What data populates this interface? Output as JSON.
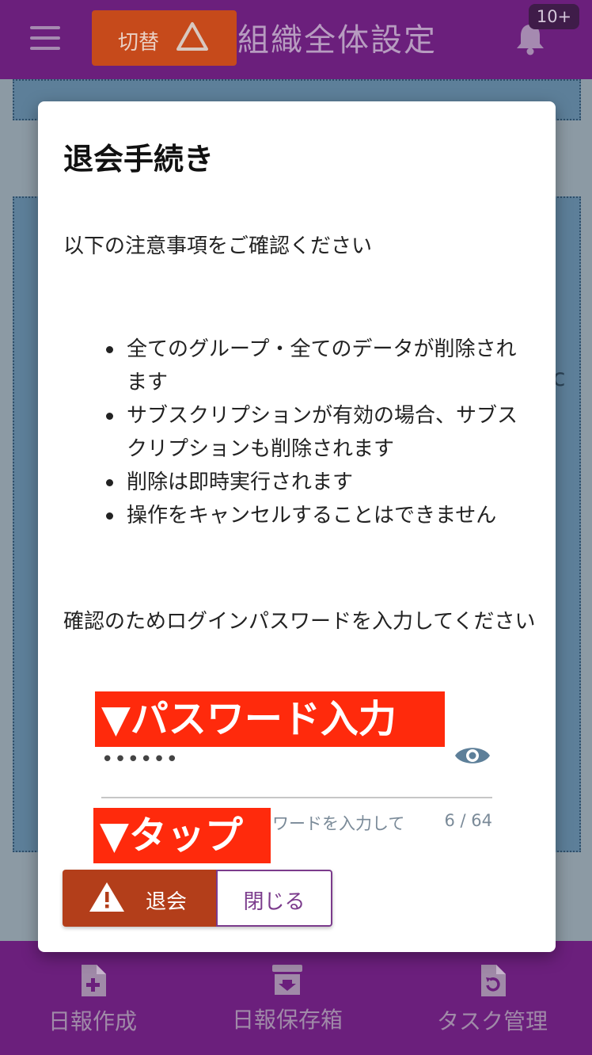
{
  "header": {
    "switch_label": "切替",
    "title": "組織全体設定",
    "notification_badge": "10+"
  },
  "background": {
    "partial_letter": "c"
  },
  "dialog": {
    "title": "退会手続き",
    "intro": "以下の注意事項をご確認ください",
    "notes": [
      "全てのグループ・全てのデータが削除されます",
      "サブスクリプションが有効の場合、サブスクリプションも削除されます",
      "削除は即時実行されます",
      "操作をキャンセルすることはできません"
    ],
    "confirm_text": "確認のためログインパスワードを入力してください",
    "password": {
      "value": "••••••",
      "hint": "ワードを入力して",
      "counter": "6 / 64"
    },
    "withdraw_label": "退会",
    "close_label": "閉じる"
  },
  "annotations": {
    "password_input": "▼パスワード入力",
    "tap": "▼タップ"
  },
  "bottom_nav": [
    {
      "label": "日報作成",
      "icon": "file-plus-icon"
    },
    {
      "label": "日報保存箱",
      "icon": "archive-icon"
    },
    {
      "label": "タスク管理",
      "icon": "file-refresh-icon"
    }
  ],
  "colors": {
    "header_bg": "#6b1f7c",
    "switch_button": "#c64a1b",
    "withdraw_button": "#b33e1a",
    "close_button_border": "#7b3b8c",
    "annotation_bg": "#ff2a0c",
    "eye_icon": "#5d7f99"
  }
}
